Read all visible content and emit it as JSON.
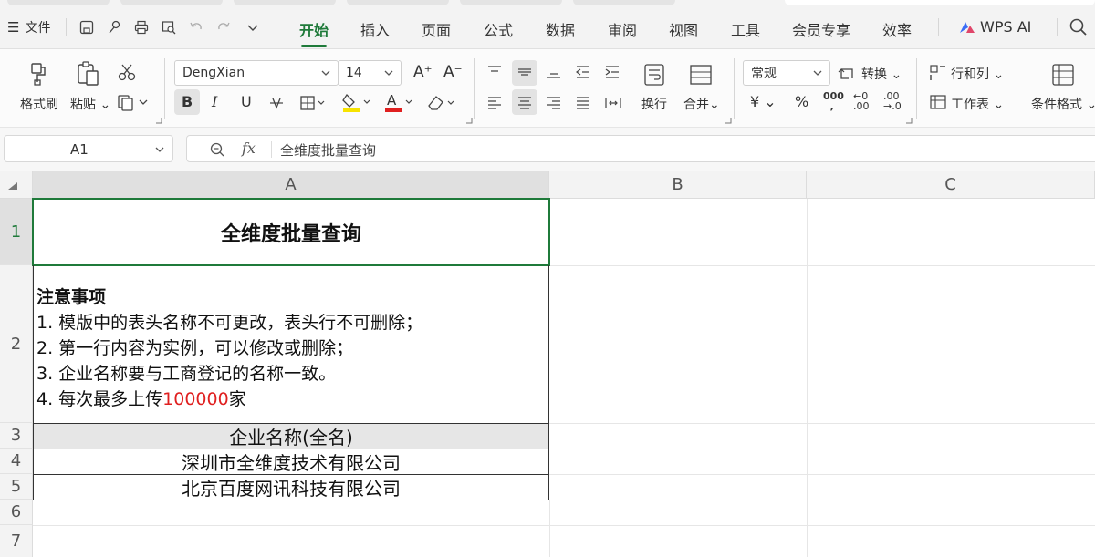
{
  "menu": {
    "file_label": "文件"
  },
  "tabs": [
    "开始",
    "插入",
    "页面",
    "公式",
    "数据",
    "审阅",
    "视图",
    "工具",
    "会员专享",
    "效率"
  ],
  "active_tab": "开始",
  "wps_ai_label": "WPS AI",
  "ribbon": {
    "format_painter": "格式刷",
    "paste": "粘贴",
    "font_name": "DengXian",
    "font_size": "14",
    "wrap": "换行",
    "merge": "合并",
    "number_format": "常规",
    "convert": "转换",
    "row_col": "行和列",
    "worksheet": "工作表",
    "conditional_format": "条件格式",
    "bold": "B",
    "italic": "I",
    "underline": "U",
    "currency": "¥",
    "percent": "%"
  },
  "formula_bar": {
    "name_box": "A1",
    "fx": "fx",
    "content": "全维度批量查询"
  },
  "columns": [
    "A",
    "B",
    "C"
  ],
  "rows": [
    "1",
    "2",
    "3",
    "4",
    "5",
    "6",
    "7"
  ],
  "cells": {
    "a1": "全维度批量查询",
    "notes_title": "注意事项",
    "note1": "1. 模版中的表头名称不可更改，表头行不可删除；",
    "note2": "2. 第一行内容为实例，可以修改或删除；",
    "note3": "3. 企业名称要与工商登记的名称一致。",
    "note4_prefix": "4. 每次最多上传",
    "note4_number": "100000",
    "note4_suffix": "家",
    "a3": "企业名称(全名)",
    "a4": "深圳市全维度技术有限公司",
    "a5": "北京百度网讯科技有限公司"
  },
  "colors": {
    "accent": "#1f7a3a",
    "highlight_red": "#e02020"
  }
}
